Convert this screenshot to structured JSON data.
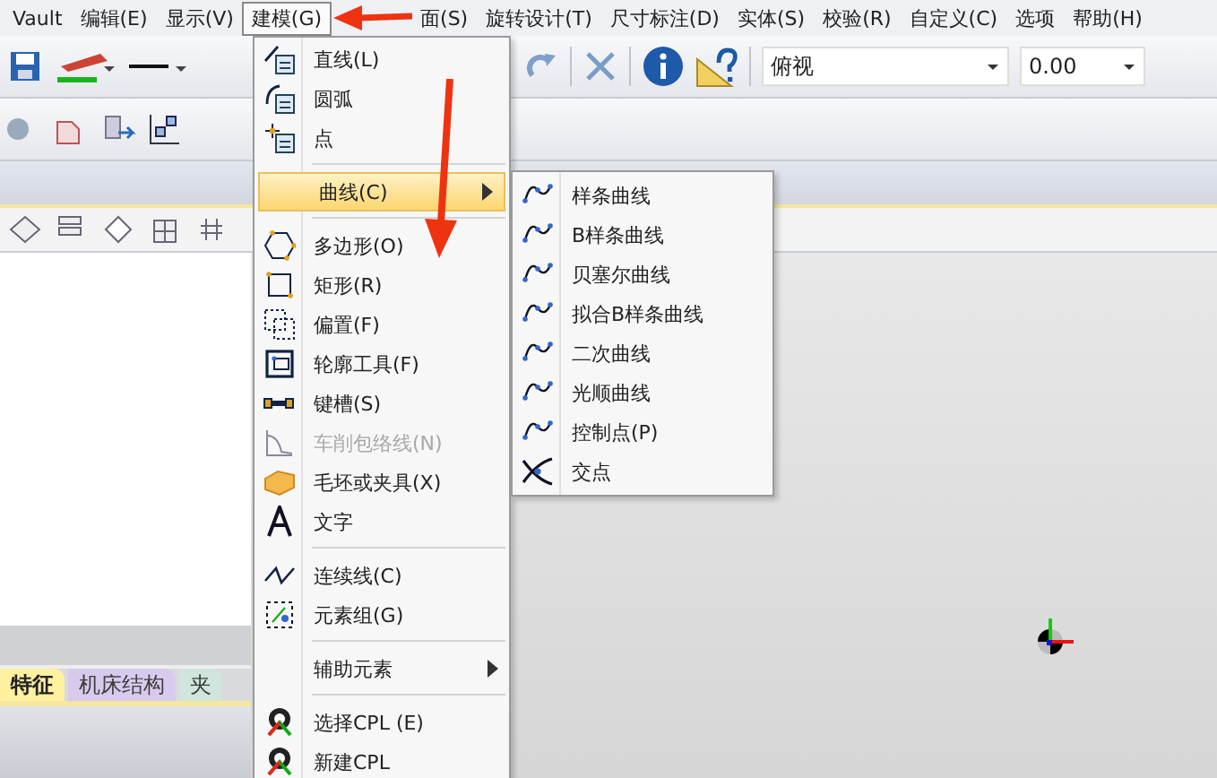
{
  "menu_bar": [
    {
      "label": "Vault",
      "selected": false
    },
    {
      "label": "编辑(E)",
      "selected": false
    },
    {
      "label": "显示(V)",
      "selected": false
    },
    {
      "label": "建模(G)",
      "selected": true
    },
    {
      "label": "面(S)",
      "selected": false
    },
    {
      "label": "旋转设计(T)",
      "selected": false
    },
    {
      "label": "尺寸标注(D)",
      "selected": false
    },
    {
      "label": "实体(S)",
      "selected": false
    },
    {
      "label": "校验(R)",
      "selected": false
    },
    {
      "label": "自定义(C)",
      "selected": false
    },
    {
      "label": "选项",
      "selected": false
    },
    {
      "label": "帮助(H)",
      "selected": false
    }
  ],
  "toolbar": {
    "view_dropdown": "俯视",
    "value_dropdown": "0.00"
  },
  "panel_tabs": [
    {
      "label": "特征",
      "selected": true,
      "color": "#fff1a0"
    },
    {
      "label": "机床结构",
      "selected": false,
      "color": "#d9c8f0"
    },
    {
      "label": "夹",
      "selected": false,
      "color": "#cfe8dc"
    }
  ],
  "menu": [
    {
      "kind": "item",
      "label": "直线(L)",
      "disabled": false,
      "selected": false
    },
    {
      "kind": "item",
      "label": "圆弧",
      "disabled": false,
      "selected": false
    },
    {
      "kind": "item",
      "label": "点",
      "disabled": false,
      "selected": false
    },
    {
      "kind": "separator"
    },
    {
      "kind": "submenu",
      "label": "曲线(C)",
      "disabled": false,
      "selected": true
    },
    {
      "kind": "separator"
    },
    {
      "kind": "item",
      "label": "多边形(O)",
      "disabled": false,
      "selected": false
    },
    {
      "kind": "item",
      "label": "矩形(R)",
      "disabled": false,
      "selected": false
    },
    {
      "kind": "item",
      "label": "偏置(F)",
      "disabled": false,
      "selected": false
    },
    {
      "kind": "item",
      "label": "轮廓工具(F)",
      "disabled": false,
      "selected": false
    },
    {
      "kind": "item",
      "label": "键槽(S)",
      "disabled": false,
      "selected": false
    },
    {
      "kind": "item",
      "label": "车削包络线(N)",
      "disabled": true,
      "selected": false
    },
    {
      "kind": "item",
      "label": "毛坯或夹具(X)",
      "disabled": false,
      "selected": false
    },
    {
      "kind": "item",
      "label": "文字",
      "disabled": false,
      "selected": false
    },
    {
      "kind": "separator"
    },
    {
      "kind": "item",
      "label": "连续线(C)",
      "disabled": false,
      "selected": false
    },
    {
      "kind": "item",
      "label": "元素组(G)",
      "disabled": false,
      "selected": false
    },
    {
      "kind": "separator"
    },
    {
      "kind": "submenu",
      "label": "辅助元素",
      "disabled": false,
      "selected": false
    },
    {
      "kind": "separator"
    },
    {
      "kind": "item",
      "label": "选择CPL (E)",
      "disabled": false,
      "selected": false
    },
    {
      "kind": "item",
      "label": "新建CPL",
      "disabled": false,
      "selected": false
    }
  ],
  "submenu": [
    {
      "label": "样条曲线"
    },
    {
      "label": "B样条曲线"
    },
    {
      "label": "贝塞尔曲线"
    },
    {
      "label": "拟合B样条曲线"
    },
    {
      "label": "二次曲线"
    },
    {
      "label": "光顺曲线"
    },
    {
      "label": "控制点(P)"
    },
    {
      "label": "交点"
    }
  ]
}
